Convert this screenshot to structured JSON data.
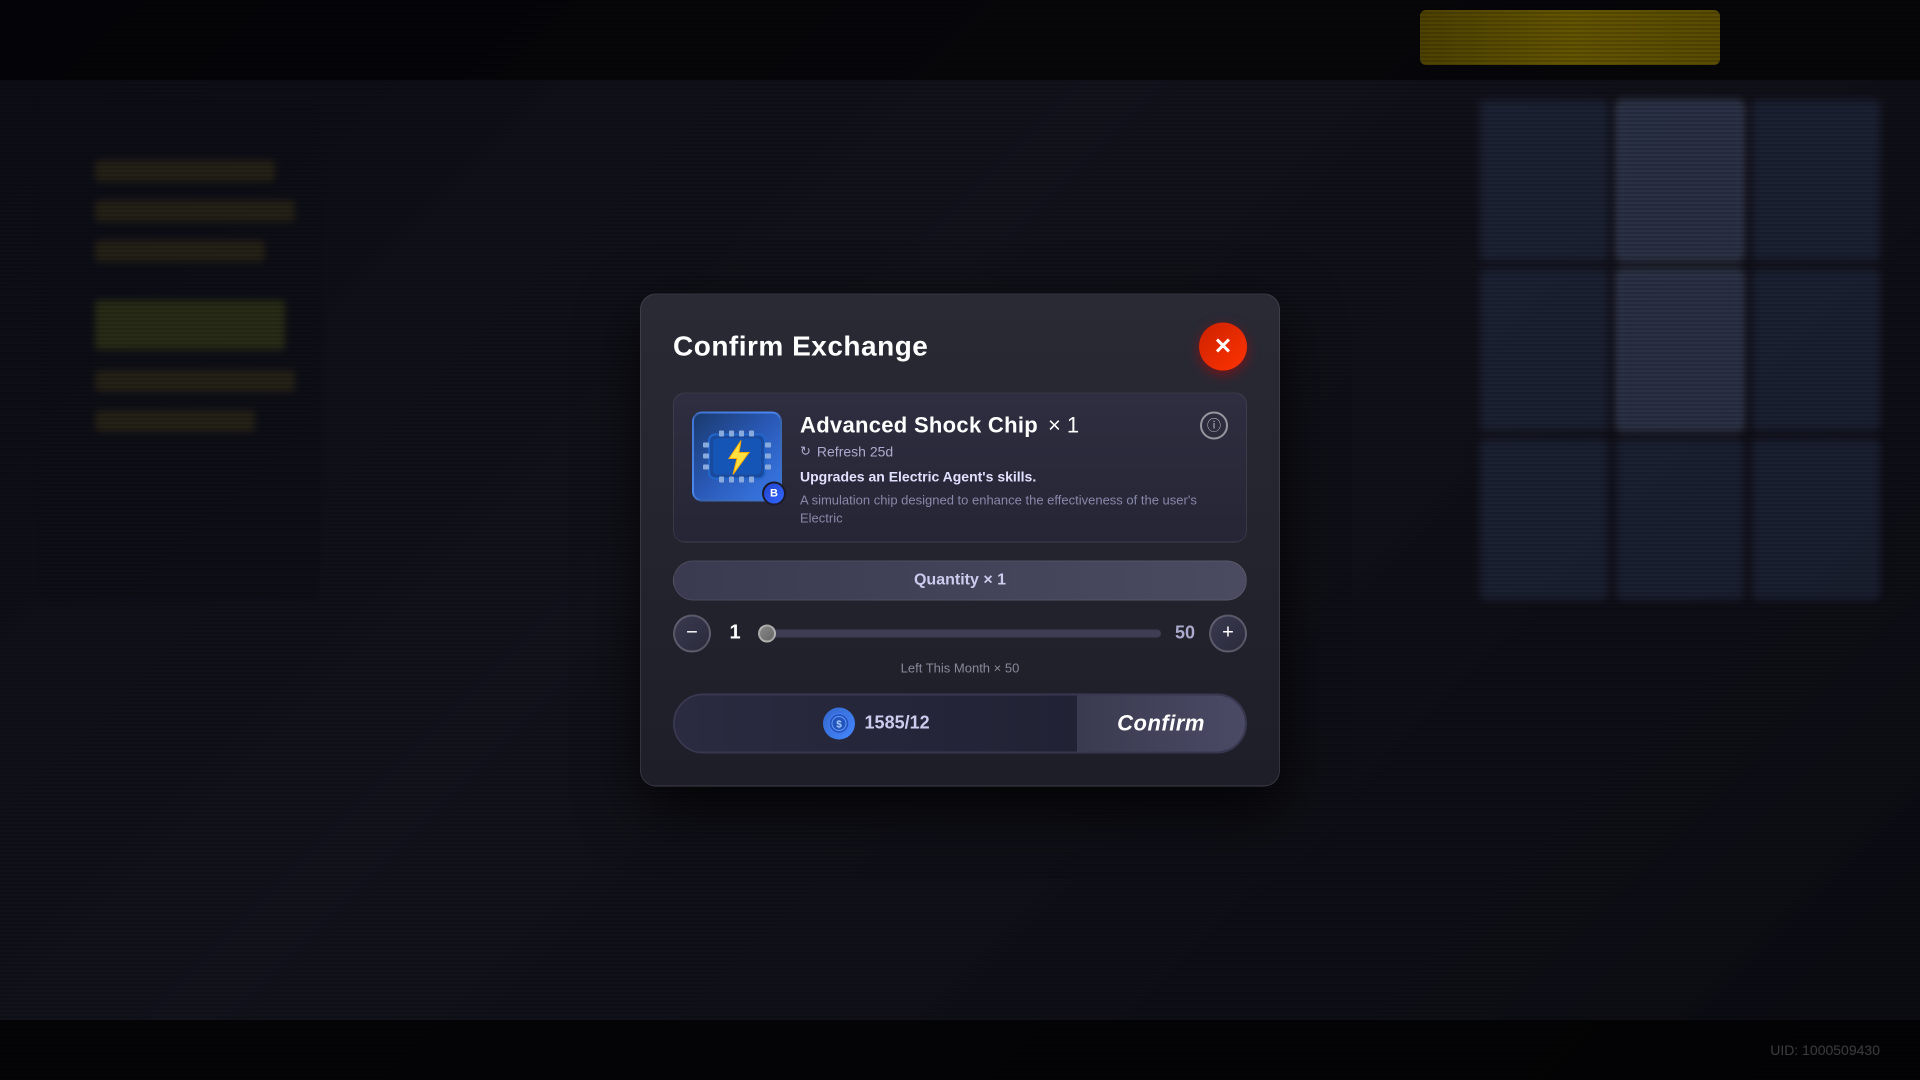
{
  "background": {
    "uid_label": "UID: 1000509430"
  },
  "modal": {
    "title": "Confirm Exchange",
    "close_label": "✕",
    "item": {
      "name": "Advanced Shock Chip",
      "quantity_label": "× 1",
      "refresh_label": "Refresh 25d",
      "desc_primary": "Upgrades an Electric Agent's skills.",
      "desc_secondary": "A simulation chip designed to enhance the effectiveness of the user's Electric",
      "badge": "B"
    },
    "quantity_bar_label": "Quantity × 1",
    "qty_current": "1",
    "qty_max": "50",
    "qty_left_text": "Left This Month × 50",
    "currency_amount": "1585/12",
    "confirm_label": "Confirm",
    "info_icon_label": "ⓘ"
  }
}
